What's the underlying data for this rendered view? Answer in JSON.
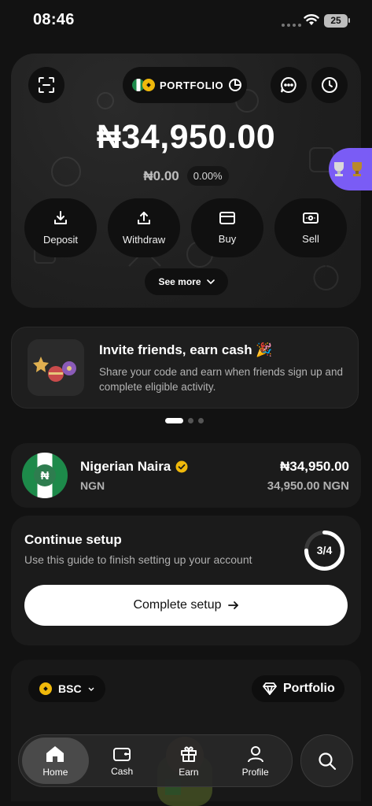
{
  "status_bar": {
    "time": "08:46",
    "battery": "25"
  },
  "header": {
    "portfolio_label": "PORTFOLIO"
  },
  "balance": {
    "amount": "₦34,950.00",
    "change_amount": "₦0.00",
    "change_percent": "0.00%"
  },
  "actions": [
    {
      "label": "Deposit",
      "icon": "download-icon"
    },
    {
      "label": "Withdraw",
      "icon": "upload-icon"
    },
    {
      "label": "Buy",
      "icon": "card-icon"
    },
    {
      "label": "Sell",
      "icon": "cash-icon"
    }
  ],
  "see_more_label": "See more",
  "invite": {
    "title": "Invite friends, earn cash 🎉",
    "description": "Share your code and earn when friends sign up and complete eligible activity."
  },
  "pager": {
    "active_index": 0,
    "count": 3
  },
  "asset": {
    "name": "Nigerian Naira",
    "code": "NGN",
    "amount": "₦34,950.00",
    "amount_native": "34,950.00 NGN",
    "symbol": "₦"
  },
  "setup": {
    "title": "Continue setup",
    "description": "Use this guide to finish setting up your account",
    "progress_text": "3/4",
    "progress": 0.75,
    "button_label": "Complete setup"
  },
  "chain_selector": {
    "label": "BSC"
  },
  "portfolio_button": {
    "label": "Portfolio"
  },
  "nav": {
    "items": [
      {
        "label": "Home",
        "icon": "home-icon",
        "active": true
      },
      {
        "label": "Cash",
        "icon": "wallet-icon",
        "active": false
      },
      {
        "label": "Earn",
        "icon": "gift-icon",
        "active": false
      },
      {
        "label": "Profile",
        "icon": "person-icon",
        "active": false
      }
    ]
  },
  "colors": {
    "accent_purple": "#7a5cf5",
    "verified_gold": "#f0b90b",
    "naira_green": "#1d8a4a"
  }
}
